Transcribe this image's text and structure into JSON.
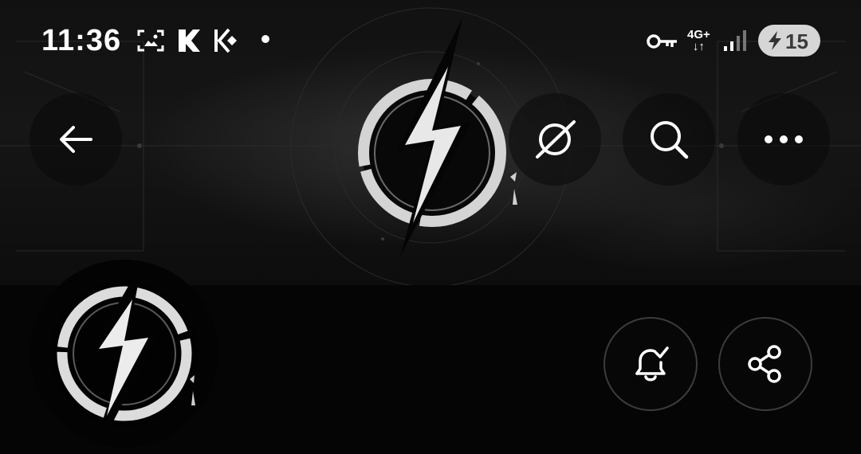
{
  "status_bar": {
    "time": "11:36",
    "icons": [
      "screenshot-icon",
      "kucoin-k-icon",
      "kucoin-logo-icon",
      "notification-dot",
      "vpn-key-icon",
      "network-4g-icon",
      "signal-icon"
    ],
    "network_label_top": "4G+",
    "network_label_bottom": "↓↑",
    "battery_percent": "15"
  },
  "top_bar": {
    "back_icon": "arrow-left-icon",
    "hide_icon": "eye-slash-icon",
    "search_icon": "search-icon",
    "more_icon": "more-horizontal-icon"
  },
  "profile": {
    "banner_logo": "lightning-bolt-circle-logo",
    "avatar_logo": "lightning-bolt-circle-logo",
    "actions": {
      "notify_icon": "bell-check-icon",
      "share_icon": "share-icon"
    }
  },
  "colors": {
    "background": "#050505",
    "banner": "#141414",
    "button_border": "#3c3c3c",
    "battery_pill": "#d6d6d6"
  }
}
